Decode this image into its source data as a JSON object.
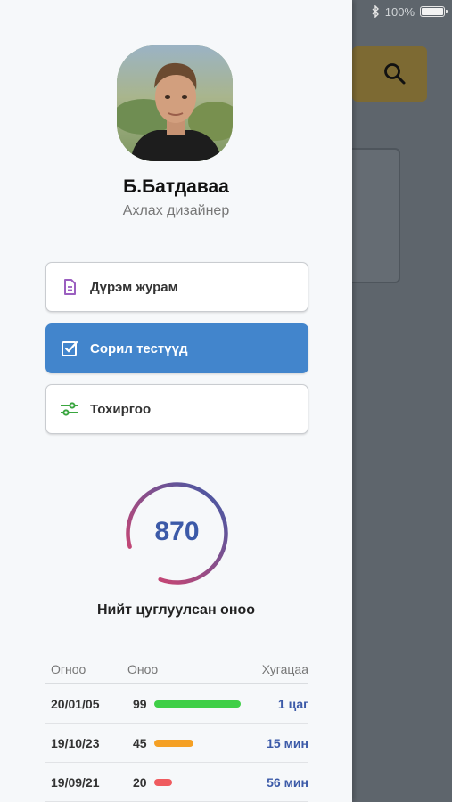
{
  "status_bar": {
    "battery_text": "100%"
  },
  "profile": {
    "name": "Б.Батдаваа",
    "role": "Ахлах дизайнер"
  },
  "menu": [
    {
      "label": "Дүрэм журам",
      "icon": "document-icon",
      "active": false
    },
    {
      "label": "Сорил тестүүд",
      "icon": "checkbox-icon",
      "active": true
    },
    {
      "label": "Тохиргоо",
      "icon": "sliders-icon",
      "active": false
    }
  ],
  "score": {
    "value": "870",
    "label": "Нийт цуглуулсан оноо",
    "fraction": 0.85
  },
  "table": {
    "headers": [
      "Огноо",
      "Оноо",
      "Хугацаа"
    ],
    "rows": [
      {
        "date": "20/01/05",
        "score": "99",
        "time": "1 цаг",
        "bar_percent": 99,
        "bar_color": "#3fcf47"
      },
      {
        "date": "19/10/23",
        "score": "45",
        "time": "15 мин",
        "bar_percent": 45,
        "bar_color": "#f5a024"
      },
      {
        "date": "19/09/21",
        "score": "20",
        "time": "56 мин",
        "bar_percent": 20,
        "bar_color": "#ef5b5f"
      }
    ]
  },
  "colors": {
    "accent": "#4285cc",
    "score_text": "#3c5aa8",
    "ring_start": "#3c5aa8",
    "ring_end": "#e0426a"
  }
}
